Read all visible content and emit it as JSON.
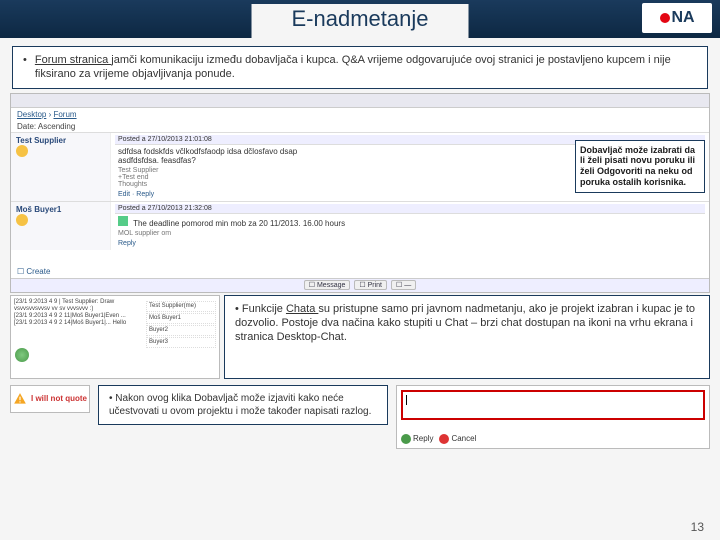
{
  "header": {
    "title": "E-nadmetanje",
    "logo_text": "NA"
  },
  "callout_main": {
    "prefix": "Forum stranica ",
    "rest": "jamči komunikaciju između dobavljača i kupca. Q&A vrijeme odgovarujuće ovoj stranici je postavljeno kupcem i nije fiksirano za vrijeme objavljivanja ponude."
  },
  "app": {
    "breadcrumb": {
      "a": "Desktop",
      "b": "Forum"
    },
    "date_label": "Date: Ascending",
    "posts": [
      {
        "author": "Test Supplier",
        "when": "Posted a 27/10/2013 21:01:08",
        "body_line1": "sdfdsa fodskfds včlkodfsfaodp idsa dčlosfavo dsap",
        "body_line2": "asdfdsfdsa. feasdfas?",
        "sig_a": "Test Supplier",
        "sig_b": "+Test end",
        "sig_c": "Thoughts",
        "actions": "Edit · Reply"
      },
      {
        "author": "Moš Buyer1",
        "when": "Posted a 27/10/2013 21:32:08",
        "body": "The deadline pomorod min mob za 20 11/2013. 16.00 hours",
        "sig_a": "MOL supplier om",
        "actions": "Reply"
      }
    ],
    "bottom_buttons": [
      "☐ Message",
      "☐ Print",
      "☐ —"
    ],
    "create_label": "☐ Create"
  },
  "sidebox": "Dobavljač može izabrati da li želi pisati novu poruku ili želi Odgovoriti na neku od poruka ostalih korisnika.",
  "chat": {
    "lines": [
      "[23/1 9:2013 4 9 | Test Supplier: Draw",
      "vsvvsvvsvvsv vv sv vvvsvvv :)",
      "[23/1 9:2013 4 9 2 11|Moš Buyer1|Even ...",
      "[23/1 9:2013 4 9 2 14|Moš Buyer1|... Hello"
    ],
    "side": [
      "Test Supplier(me)",
      "Moš Buyer1",
      "Buyer2",
      "Buyer3"
    ]
  },
  "callout_chat": {
    "prefix": "Funkcije ",
    "u": "Chata ",
    "rest": "su pristupne samo pri javnom nadmetanju, ako je projekt izabran i kupac je to dozvolio. Postoje dva načina kako stupiti u Chat – brzi chat dostupan na ikoni na vrhu ekrana i stranica Desktop-Chat."
  },
  "quote_button": "I will not quote",
  "callout_quote": "Nakon ovog klika Dobavljač može izjaviti kako neće učestvovati u ovom projektu i može također napisati razlog.",
  "input_shot": {
    "reply": "Reply",
    "cancel": "Cancel"
  },
  "page_number": "13"
}
